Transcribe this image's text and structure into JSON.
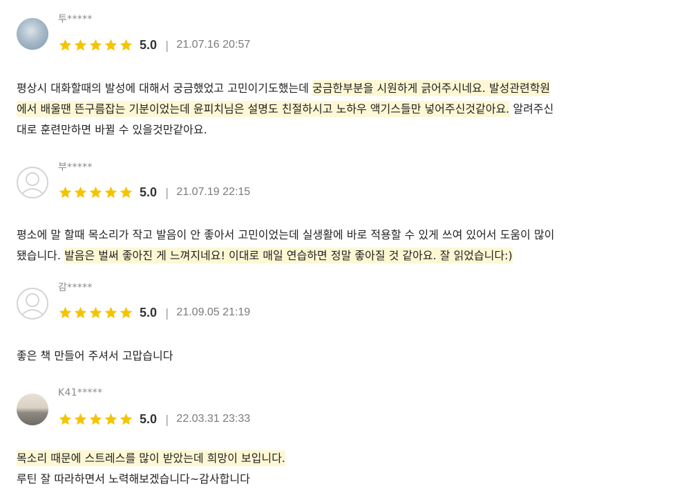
{
  "colors": {
    "star": "#f5c400",
    "highlight": "#fdf7d4"
  },
  "reviews": [
    {
      "avatar": "photo-avatar",
      "name": "투*****",
      "rating": 5,
      "score": "5.0",
      "sep": "|",
      "date": "21.07.16 20:57",
      "text_plain": "평상시 대화할때의 발성에 대해서 궁금했었고 고민이기도했는데 ",
      "text_highlight": "궁금한부분을 시원하게 긁어주시네요. 발성관련학원\n에서 배울땐 뜬구름잡는 기분이었는데 윤피치님은 설명도 친절하시고 노하우 액기스들만 넣어주신것같아요.",
      "text_plain_after": " 알려주신\n대로 훈련만하면 바뀔 수 있을것만같아요."
    },
    {
      "avatar": "default-avatar",
      "name": "부*****",
      "rating": 5,
      "score": "5.0",
      "sep": "|",
      "date": "21.07.19 22:15",
      "text_plain": "평소에 말 할때 목소리가 작고 발음이 안 좋아서 고민이었는데 실생활에 바로 적용할 수 있게 쓰여 있어서 도움이 많이\n됐습니다. ",
      "text_highlight": "발음은 벌써 좋아진 게 느껴지네요! 이대로 매일 연습하면 정말 좋아질 것 같아요. 잘 읽었습니다:)",
      "text_plain_after": ""
    },
    {
      "avatar": "default-avatar",
      "name": "감*****",
      "rating": 5,
      "score": "5.0",
      "sep": "|",
      "date": "21.09.05 21:19",
      "text_plain": "좋은 책 만들어 주셔서 고맙습니다",
      "text_highlight": "",
      "text_plain_after": ""
    },
    {
      "avatar": "photo-avatar",
      "name": "K41*****",
      "rating": 5,
      "score": "5.0",
      "sep": "|",
      "date": "22.03.31 23:33",
      "text_plain": "",
      "text_highlight": "목소리 때문에 스트레스를 많이 받았는데 희망이 보입니다.",
      "text_plain_after": "\n루틴 잘 따라하면서 노력해보겠습니다~감사합니다"
    }
  ]
}
